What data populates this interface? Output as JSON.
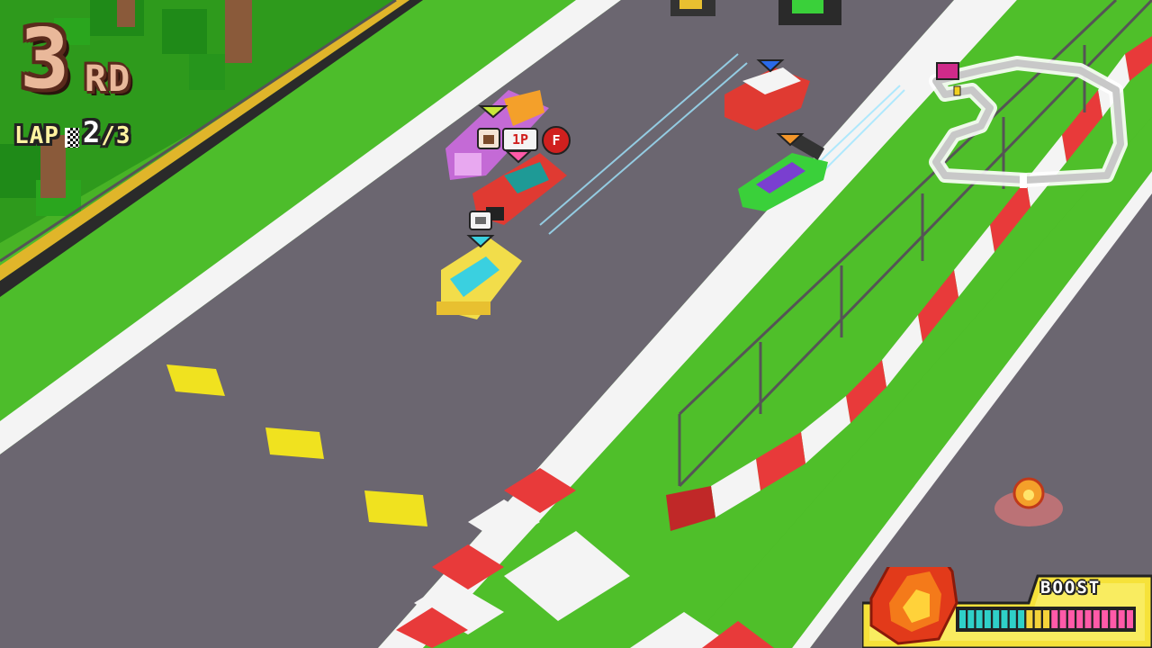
{
  "race": {
    "position": "3",
    "position_suffix": "RD",
    "lap_label": "LAP",
    "lap_current": "2",
    "lap_separator": "/",
    "lap_total": "3"
  },
  "markers": {
    "player_tag": "1P",
    "fire_badge": "F"
  },
  "boost": {
    "label": "BOOST",
    "segments_filled": 21,
    "segments_total": 21
  },
  "colors": {
    "grass": "#4fbf2a",
    "track": "#6b6670",
    "curb_red": "#e83a3a",
    "boost_bar": [
      "#2fd0c8",
      "#f4d23a",
      "#ff5aa8"
    ]
  }
}
